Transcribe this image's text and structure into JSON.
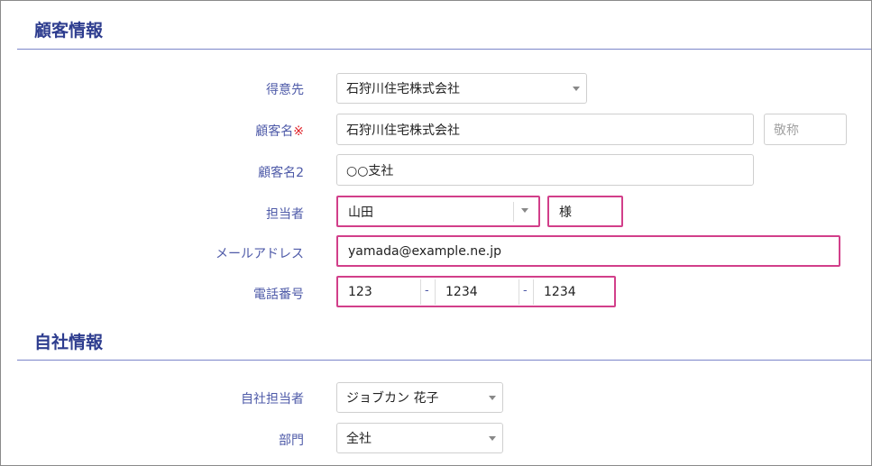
{
  "customer_section": {
    "title": "顧客情報",
    "client": {
      "label": "得意先",
      "value": "石狩川住宅株式会社"
    },
    "customer_name": {
      "label": "顧客名",
      "required_mark": "※",
      "value": "石狩川住宅株式会社",
      "honorific_placeholder": "敬称"
    },
    "customer_name2": {
      "label": "顧客名2",
      "value": "○○支社"
    },
    "contact_person": {
      "label": "担当者",
      "value": "山田",
      "honorific": "様"
    },
    "email": {
      "label": "メールアドレス",
      "value": "yamada@example.ne.jp"
    },
    "phone": {
      "label": "電話番号",
      "part1": "123",
      "part2": "1234",
      "part3": "1234",
      "separator": "-"
    }
  },
  "company_section": {
    "title": "自社情報",
    "staff": {
      "label": "自社担当者",
      "value": "ジョブカン 花子"
    },
    "department": {
      "label": "部門",
      "value": "全社"
    }
  },
  "icons": {
    "dropdown": "chevron-down-icon"
  },
  "colors": {
    "label": "#4e5aa8",
    "section_title": "#2e3d8f",
    "highlight": "#d23f8a",
    "required": "#e0252c"
  }
}
